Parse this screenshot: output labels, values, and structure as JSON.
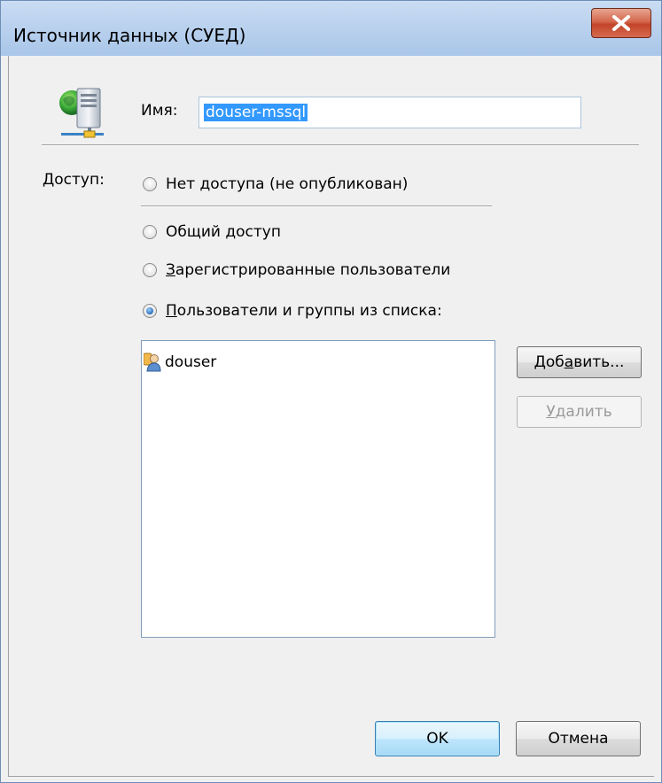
{
  "window": {
    "title": "Источник данных (СУЕД)",
    "close_label": "X"
  },
  "name": {
    "label": "Имя:",
    "value": "douser-mssql"
  },
  "access": {
    "label": "Доступ:",
    "options": [
      {
        "label": "Нет доступа (не опубликован)",
        "checked": false
      },
      {
        "label": "Общий доступ",
        "checked": false
      },
      {
        "prefix": "",
        "underline": "З",
        "rest": "арегистрированные пользователи",
        "checked": false
      },
      {
        "prefix": "",
        "underline": "П",
        "rest": "ользователи и группы из списка:",
        "checked": true
      }
    ]
  },
  "list": {
    "items": [
      {
        "name": "douser",
        "icon": "user-icon"
      }
    ]
  },
  "buttons": {
    "add": {
      "prefix": "Доб",
      "underline": "а",
      "rest": "вить..."
    },
    "remove": {
      "prefix": "",
      "underline": "У",
      "rest": "далить"
    },
    "ok": "OK",
    "cancel": "Отмена"
  },
  "colors": {
    "selection": "#3399ff",
    "close_button": "#c2442a",
    "title_bar": "#b9d1ee"
  }
}
